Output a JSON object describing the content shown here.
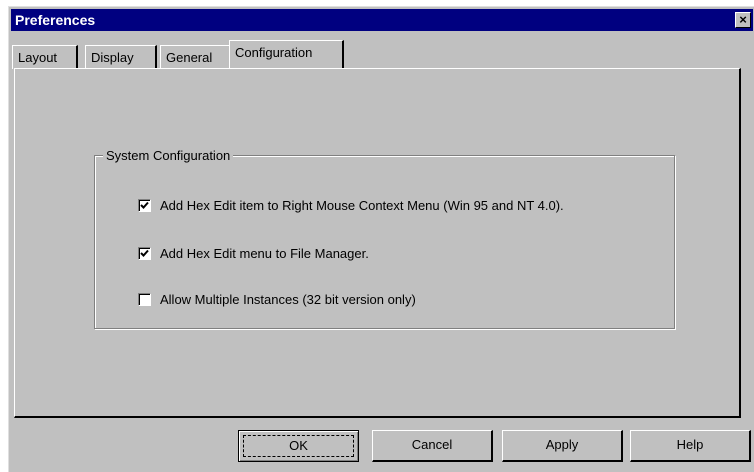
{
  "window": {
    "title": "Preferences",
    "close_label": "×"
  },
  "tabs": [
    {
      "label": "Layout"
    },
    {
      "label": "Display"
    },
    {
      "label": "General"
    },
    {
      "label": "Configuration",
      "active": true
    }
  ],
  "group": {
    "legend": "System Configuration",
    "options": [
      {
        "label": "Add Hex Edit item to Right Mouse Context Menu (Win 95 and NT 4.0).",
        "checked": true
      },
      {
        "label": "Add Hex Edit menu to File Manager.",
        "checked": true
      },
      {
        "label": "Allow Multiple Instances (32 bit version only)",
        "checked": false
      }
    ]
  },
  "buttons": {
    "ok": "OK",
    "cancel": "Cancel",
    "apply": "Apply",
    "help": "Help"
  }
}
